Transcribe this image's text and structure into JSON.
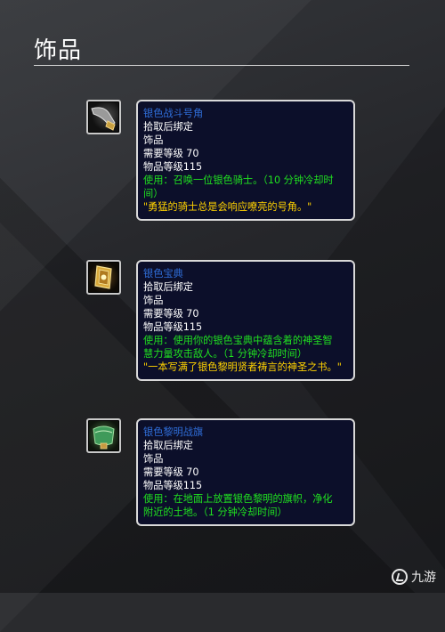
{
  "header": {
    "title": "饰品"
  },
  "items": [
    {
      "icon": "horn-icon",
      "name": "银色战斗号角",
      "bind": "拾取后绑定",
      "slot": "饰品",
      "req_level": "需要等级 70",
      "item_level": "物品等级115",
      "use": [
        "使用：召唤一位银色骑士。（10 分钟冷却时",
        "间）"
      ],
      "flavor": [
        "\"勇猛的骑士总是会响应嘹亮的号角。\""
      ]
    },
    {
      "icon": "tome-icon",
      "name": "银色宝典",
      "bind": "拾取后绑定",
      "slot": "饰品",
      "req_level": "需要等级 70",
      "item_level": "物品等级115",
      "use": [
        "使用：使用你的银色宝典中蕴含着的神圣智",
        "慧力量攻击敌人。（1 分钟冷却时间）"
      ],
      "flavor": [
        "\"一本写满了银色黎明贤者祷言的神圣之书。\""
      ]
    },
    {
      "icon": "banner-icon",
      "name": "银色黎明战旗",
      "bind": "拾取后绑定",
      "slot": "饰品",
      "req_level": "需要等级 70",
      "item_level": "物品等级115",
      "use": [
        "使用：在地面上放置银色黎明的旗帜，净化",
        "附近的土地。（1 分钟冷却时间）"
      ],
      "flavor": []
    }
  ],
  "watermark": {
    "text": "九游"
  }
}
